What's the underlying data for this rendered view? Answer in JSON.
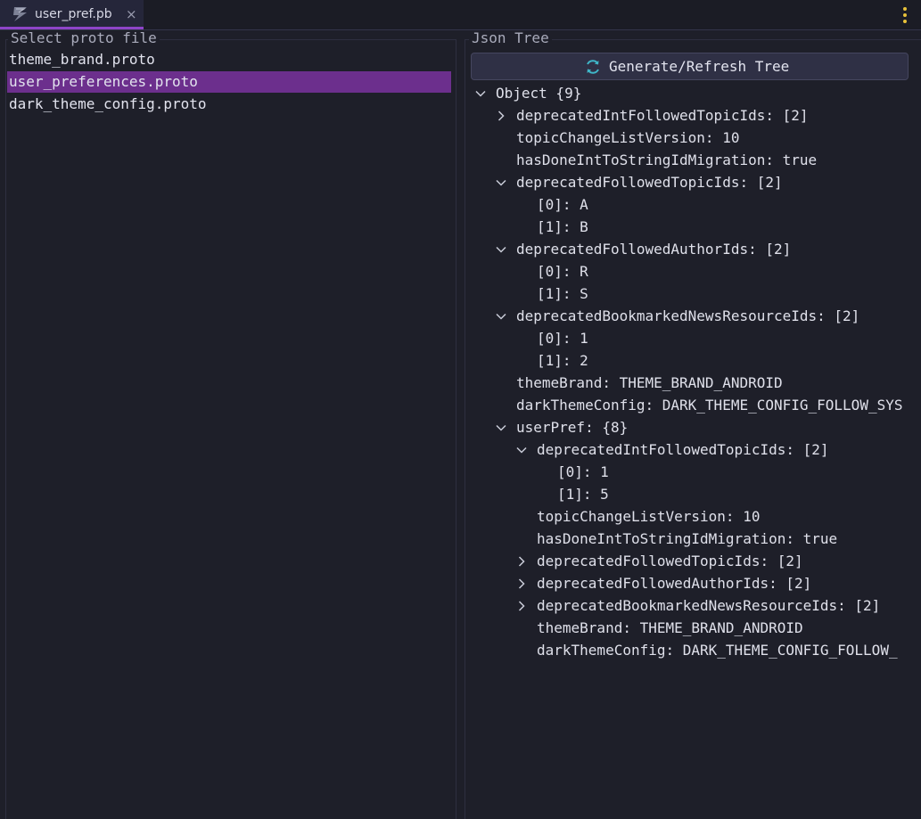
{
  "tab": {
    "label": "user_pref.pb",
    "close": "×"
  },
  "left": {
    "title": "Select proto file",
    "files": [
      "theme_brand.proto",
      "user_preferences.proto",
      "dark_theme_config.proto"
    ],
    "selected_index": 1
  },
  "right": {
    "title": "Json Tree",
    "button_label": "Generate/Refresh Tree",
    "tree": [
      {
        "depth": 0,
        "chev": "down",
        "text": "Object {9}"
      },
      {
        "depth": 1,
        "chev": "right",
        "text": "deprecatedIntFollowedTopicIds: [2]"
      },
      {
        "depth": 1,
        "chev": "",
        "text": "topicChangeListVersion: 10"
      },
      {
        "depth": 1,
        "chev": "",
        "text": "hasDoneIntToStringIdMigration: true"
      },
      {
        "depth": 1,
        "chev": "down",
        "text": "deprecatedFollowedTopicIds: [2]"
      },
      {
        "depth": 2,
        "chev": "",
        "text": "[0]: A"
      },
      {
        "depth": 2,
        "chev": "",
        "text": "[1]: B"
      },
      {
        "depth": 1,
        "chev": "down",
        "text": "deprecatedFollowedAuthorIds: [2]"
      },
      {
        "depth": 2,
        "chev": "",
        "text": "[0]: R"
      },
      {
        "depth": 2,
        "chev": "",
        "text": "[1]: S"
      },
      {
        "depth": 1,
        "chev": "down",
        "text": "deprecatedBookmarkedNewsResourceIds: [2]"
      },
      {
        "depth": 2,
        "chev": "",
        "text": "[0]: 1"
      },
      {
        "depth": 2,
        "chev": "",
        "text": "[1]: 2"
      },
      {
        "depth": 1,
        "chev": "",
        "text": "themeBrand: THEME_BRAND_ANDROID"
      },
      {
        "depth": 1,
        "chev": "",
        "text": "darkThemeConfig: DARK_THEME_CONFIG_FOLLOW_SYS"
      },
      {
        "depth": 1,
        "chev": "down",
        "text": "userPref: {8}"
      },
      {
        "depth": 2,
        "chev": "down",
        "text": "deprecatedIntFollowedTopicIds: [2]"
      },
      {
        "depth": 3,
        "chev": "",
        "text": "[0]: 1"
      },
      {
        "depth": 3,
        "chev": "",
        "text": "[1]: 5"
      },
      {
        "depth": 2,
        "chev": "",
        "text": "topicChangeListVersion: 10"
      },
      {
        "depth": 2,
        "chev": "",
        "text": "hasDoneIntToStringIdMigration: true"
      },
      {
        "depth": 2,
        "chev": "right",
        "text": "deprecatedFollowedTopicIds: [2]"
      },
      {
        "depth": 2,
        "chev": "right",
        "text": "deprecatedFollowedAuthorIds: [2]"
      },
      {
        "depth": 2,
        "chev": "right",
        "text": "deprecatedBookmarkedNewsResourceIds: [2]"
      },
      {
        "depth": 2,
        "chev": "",
        "text": "themeBrand: THEME_BRAND_ANDROID"
      },
      {
        "depth": 2,
        "chev": "",
        "text": "darkThemeConfig: DARK_THEME_CONFIG_FOLLOW_"
      }
    ]
  },
  "colors": {
    "accent": "#8e44c8",
    "selection": "#6c2f8d",
    "refresh_icon": "#3fb6c8",
    "menu_dots": "#e8c23a"
  },
  "icons": {
    "tab": "protobuf-file-icon",
    "menu": "more-vertical-icon",
    "button": "refresh-icon",
    "expand": "chevron-down-icon",
    "collapse": "chevron-right-icon"
  }
}
